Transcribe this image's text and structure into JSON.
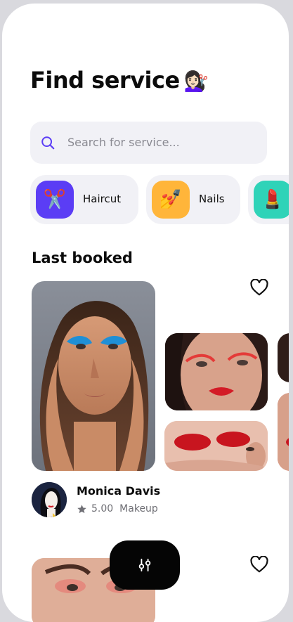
{
  "header": {
    "title": "Find service",
    "title_emoji": "💇🏻‍♀️"
  },
  "search": {
    "placeholder": "Search for service..."
  },
  "categories": [
    {
      "label": "Haircut",
      "emoji": "✂️",
      "color": "#5b3df5"
    },
    {
      "label": "Nails",
      "emoji": "💅",
      "color": "#ffb53a"
    },
    {
      "label": "",
      "emoji": "💄",
      "color": "#2fd3b8"
    }
  ],
  "last_booked": {
    "title": "Last booked",
    "cards": [
      {
        "name": "Monica Davis",
        "rating": "5.00",
        "category": "Makeup"
      }
    ]
  },
  "icons": [
    "search-icon",
    "scissors-icon",
    "nail-polish-icon",
    "lipstick-icon",
    "heart-icon",
    "star-icon",
    "filter-sliders-icon"
  ],
  "colors": {
    "accent": "#5b3df5",
    "background": "#ffffff",
    "chip_bg": "#f1f1f6",
    "button": "#050505"
  }
}
